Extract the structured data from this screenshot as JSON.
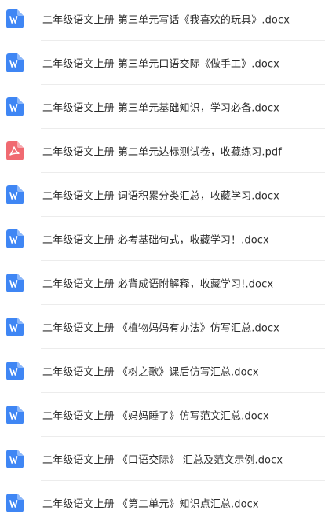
{
  "colors": {
    "docx_icon": "#3f86f4",
    "pdf_icon": "#f06a71",
    "text": "#2c2c2c",
    "divider": "#ececec"
  },
  "files": [
    {
      "name": "二年级语文上册 第三单元写话《我喜欢的玩具》.docx",
      "icon": "word-doc-icon"
    },
    {
      "name": "二年级语文上册 第三单元口语交际《做手工》.docx",
      "icon": "word-doc-icon"
    },
    {
      "name": "二年级语文上册 第三单元基础知识，学习必备.docx",
      "icon": "word-doc-icon"
    },
    {
      "name": "二年级语文上册 第二单元达标测试卷，收藏练习.pdf",
      "icon": "pdf-doc-icon"
    },
    {
      "name": "二年级语文上册 词语积累分类汇总，收藏学习.docx",
      "icon": "word-doc-icon"
    },
    {
      "name": "二年级语文上册 必考基础句式，收藏学习！.docx",
      "icon": "word-doc-icon"
    },
    {
      "name": "二年级语文上册 必背成语附解释，收藏学习!.docx",
      "icon": "word-doc-icon"
    },
    {
      "name": "二年级语文上册 《植物妈妈有办法》仿写汇总.docx",
      "icon": "word-doc-icon"
    },
    {
      "name": "二年级语文上册 《树之歌》课后仿写汇总.docx",
      "icon": "word-doc-icon"
    },
    {
      "name": "二年级语文上册 《妈妈睡了》仿写范文汇总.docx",
      "icon": "word-doc-icon"
    },
    {
      "name": "二年级语文上册 《口语交际》 汇总及范文示例.docx",
      "icon": "word-doc-icon"
    },
    {
      "name": "二年级语文上册 《第二单元》知识点汇总.docx",
      "icon": "word-doc-icon"
    }
  ]
}
